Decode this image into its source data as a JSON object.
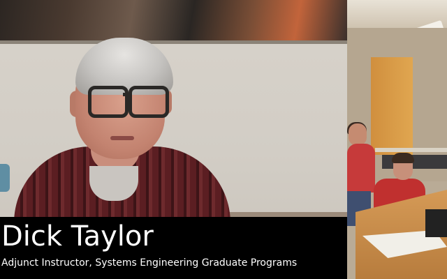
{
  "caption": {
    "name": "Dick Taylor",
    "title": "Adjunct Instructor, Systems Engineering Graduate Programs"
  },
  "colors": {
    "lower_third_background": "#000000",
    "caption_text": "#ffffff",
    "shirt": "#5b1e22",
    "door": "#d89a48",
    "student_shirt": "#c63a3a"
  }
}
